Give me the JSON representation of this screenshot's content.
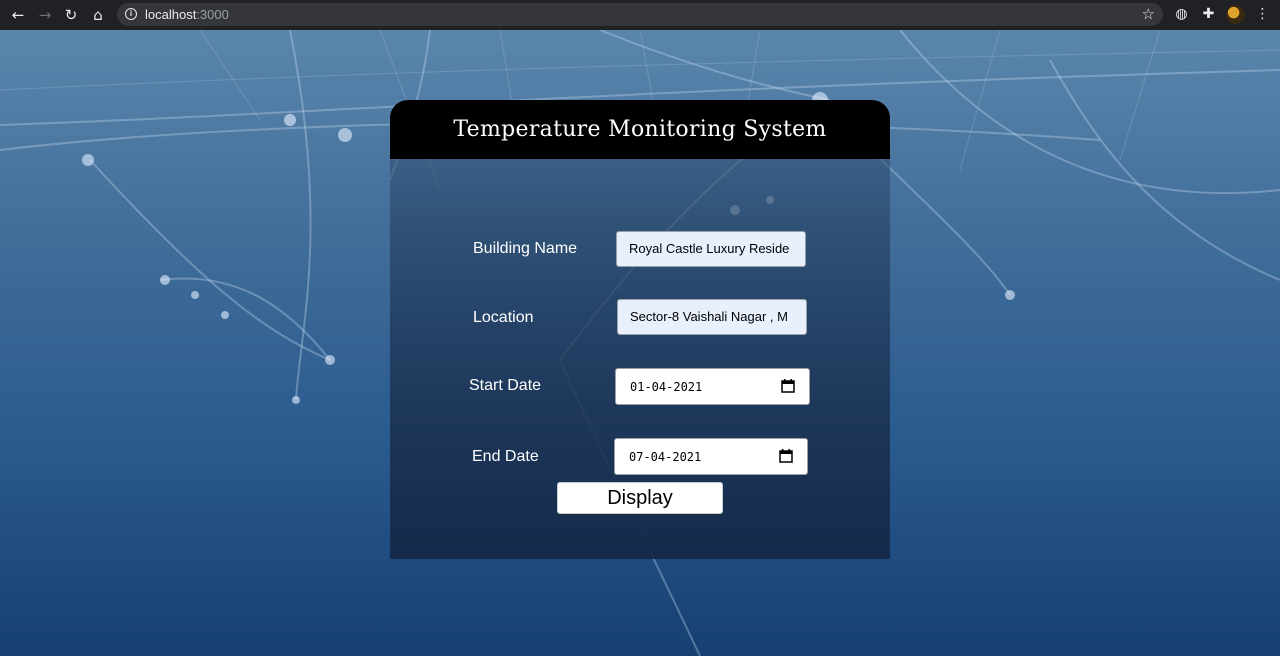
{
  "browser": {
    "url_host": "localhost",
    "url_port": ":3000",
    "icons": [
      "back-icon",
      "forward-icon",
      "reload-icon",
      "home-icon",
      "info-icon",
      "star-icon",
      "globe-icon",
      "extensions-icon",
      "menu-icon"
    ]
  },
  "app": {
    "title": "Temperature Monitoring System"
  },
  "form": {
    "building_label": "Building Name",
    "building_value": "Royal Castle Luxury Reside",
    "location_label": "Location",
    "location_value": "Sector-8 Vaishali Nagar , M",
    "start_label": "Start Date",
    "start_value": "01-04-2021",
    "end_label": "End Date",
    "end_value": "07-04-2021",
    "submit_label": "Display"
  }
}
